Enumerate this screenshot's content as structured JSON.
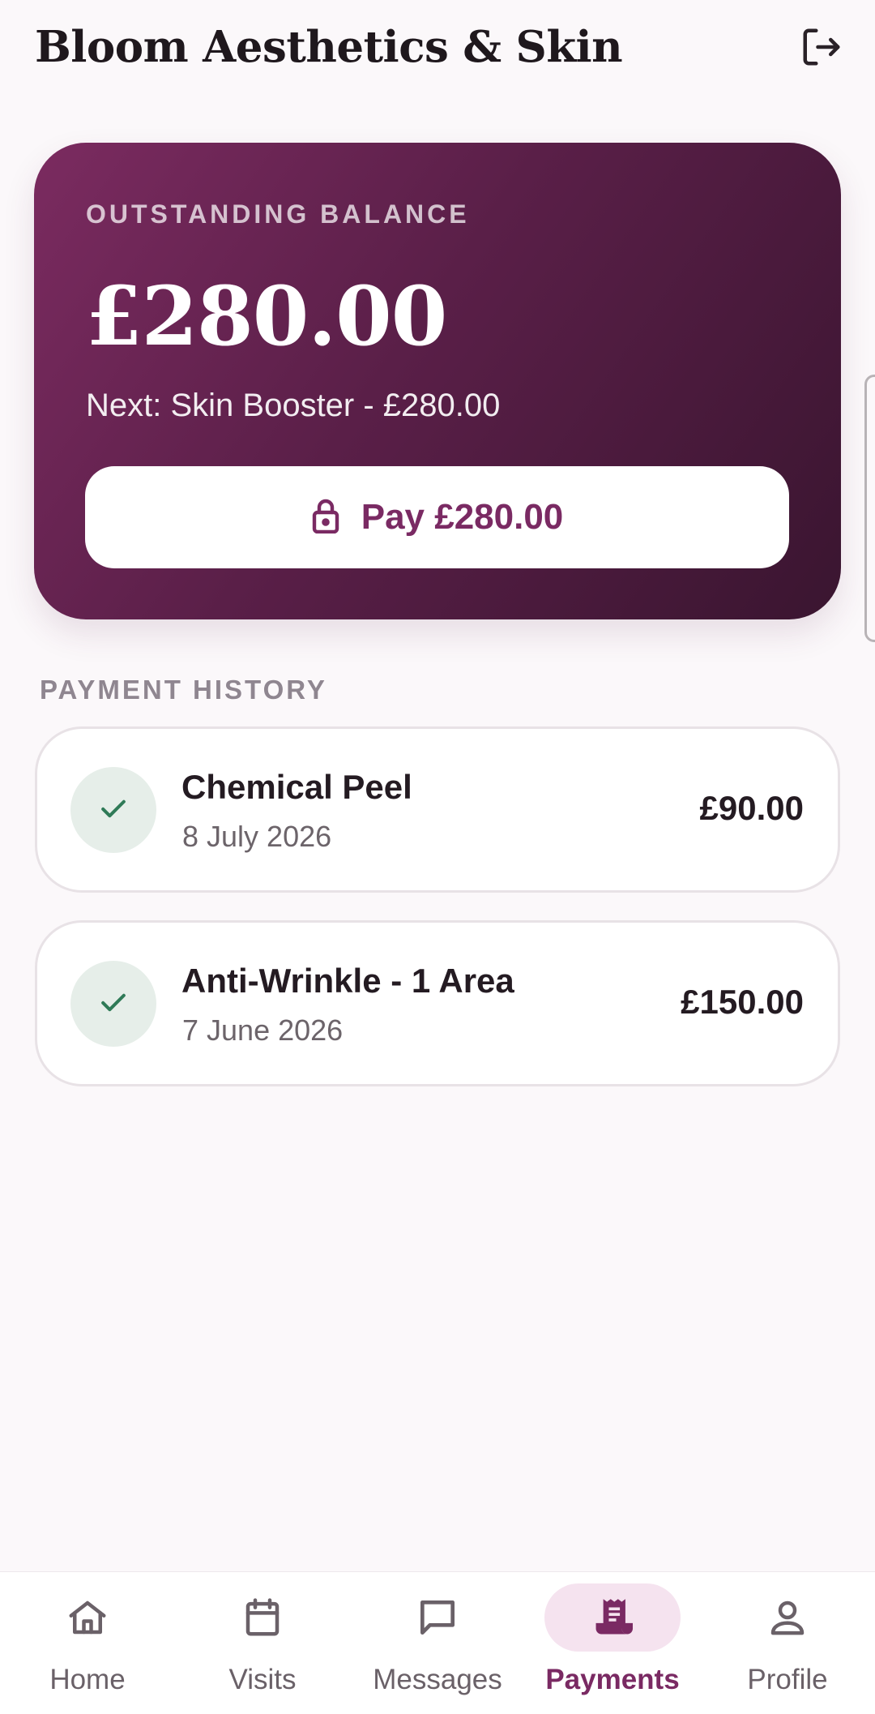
{
  "header": {
    "title": "Bloom Aesthetics & Skin",
    "logout_icon": "logout-icon"
  },
  "balance": {
    "label": "OUTSTANDING BALANCE",
    "amount": "£280.00",
    "next": "Next: Skin Booster - £280.00",
    "pay_label": "Pay £280.00",
    "pay_icon": "lock-icon"
  },
  "history": {
    "title": "PAYMENT HISTORY",
    "items": [
      {
        "title": "Chemical Peel",
        "date": "8 July 2026",
        "amount": "£90.00",
        "status_icon": "check-icon"
      },
      {
        "title": "Anti-Wrinkle - 1 Area",
        "date": "7 June 2026",
        "amount": "£150.00",
        "status_icon": "check-icon"
      }
    ]
  },
  "nav": {
    "items": [
      {
        "label": "Home",
        "icon": "home-icon",
        "active": false
      },
      {
        "label": "Visits",
        "icon": "calendar-icon",
        "active": false
      },
      {
        "label": "Messages",
        "icon": "message-icon",
        "active": false
      },
      {
        "label": "Payments",
        "icon": "receipt-icon",
        "active": true
      },
      {
        "label": "Profile",
        "icon": "person-icon",
        "active": false
      }
    ]
  },
  "colors": {
    "accent": "#7a2a63",
    "card_gradient_start": "#7b2b60",
    "card_gradient_end": "#3a1530",
    "success": "#2f7a57",
    "background": "#fbf8fa"
  }
}
